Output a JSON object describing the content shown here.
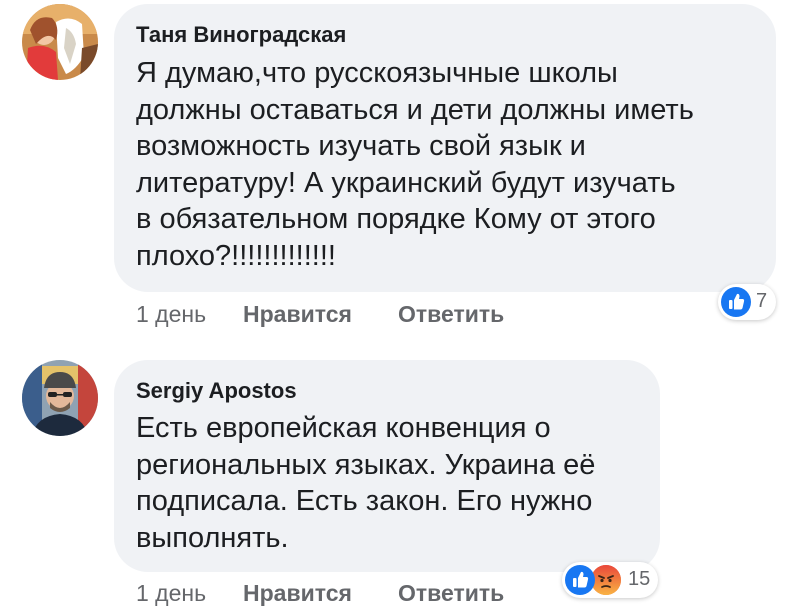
{
  "colors": {
    "bubble_background": "#f0f2f5",
    "text": "#1c1e21",
    "secondary_text": "#65676b",
    "like_blue": "#1877f2",
    "angry_orange": "#f7714c"
  },
  "comments": [
    {
      "author": "Таня Виноградская",
      "text": "Я думаю,что русскоязычные школы\nдолжны оставаться и дети  должны иметь\nвозможность изучать свой язык и\nлитературу! А украинский будут изучать\nв обязательном порядке Кому от этого\nплохо?!!!!!!!!!!!!!",
      "time": "1 день",
      "like_label": "Нравится",
      "reply_label": "Ответить",
      "reactions": [
        "like-icon"
      ],
      "reaction_count": "7"
    },
    {
      "author": "Sergiy Apostos",
      "text": "Есть европейская конвенция о\nрегиональных языках. Украина её\nподписала. Есть закон. Его нужно\nвыполнять.",
      "time": "1 день",
      "like_label": "Нравится",
      "reply_label": "Ответить",
      "reactions": [
        "like-icon",
        "angry-icon"
      ],
      "reaction_count": "15"
    }
  ]
}
